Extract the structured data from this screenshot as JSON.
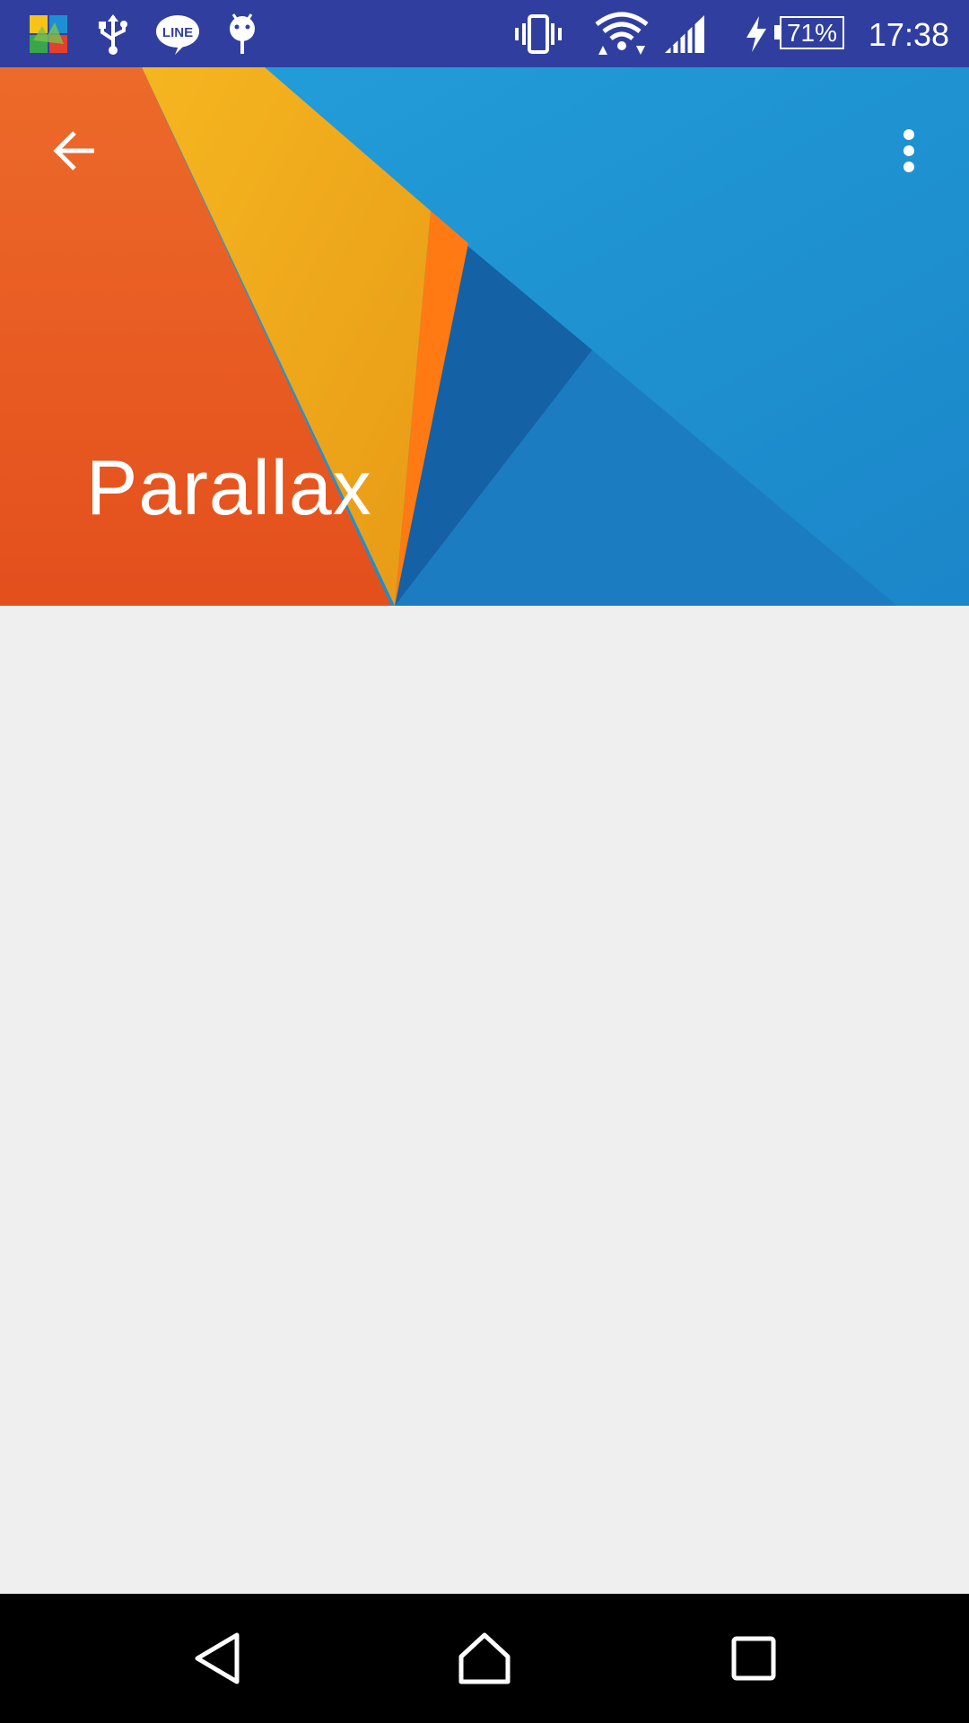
{
  "status_bar": {
    "background": "#303f9f",
    "time": "17:38",
    "battery_percent": "71%",
    "notification_icons": [
      "avg-icon",
      "usb-icon",
      "line-icon",
      "android-debug-icon"
    ],
    "system_icons": [
      "vibrate-icon",
      "wifi-icon",
      "signal-icon",
      "charging-icon",
      "battery-icon"
    ],
    "line_label": "LINE"
  },
  "header": {
    "title": "Parallax",
    "colors": {
      "orange": "#e8581f",
      "yellow": "#f0ad1c",
      "blue": "#1e90d0",
      "dark_blue": "#1565a8"
    },
    "navigation_icon": "arrow-back-icon",
    "menu_icon": "more-vert-icon"
  },
  "content": {
    "background": "#efefef"
  },
  "nav_bar": {
    "buttons": [
      "back-icon",
      "home-icon",
      "recents-icon"
    ]
  }
}
